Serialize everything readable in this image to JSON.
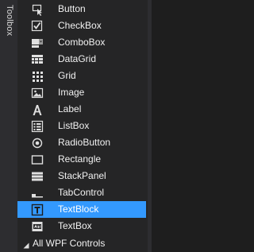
{
  "toolbox_tab": {
    "label": "Toolbox"
  },
  "items": [
    {
      "label": "Button",
      "icon": "button-pointer-icon"
    },
    {
      "label": "CheckBox",
      "icon": "checkbox-icon"
    },
    {
      "label": "ComboBox",
      "icon": "combobox-icon"
    },
    {
      "label": "DataGrid",
      "icon": "datagrid-icon"
    },
    {
      "label": "Grid",
      "icon": "grid-icon"
    },
    {
      "label": "Image",
      "icon": "image-icon"
    },
    {
      "label": "Label",
      "icon": "label-a-icon"
    },
    {
      "label": "ListBox",
      "icon": "listbox-icon"
    },
    {
      "label": "RadioButton",
      "icon": "radio-button-icon"
    },
    {
      "label": "Rectangle",
      "icon": "rectangle-icon"
    },
    {
      "label": "StackPanel",
      "icon": "stackpanel-icon"
    },
    {
      "label": "TabControl",
      "icon": "tabcontrol-icon"
    },
    {
      "label": "TextBlock",
      "icon": "textblock-icon",
      "selected": true
    },
    {
      "label": "TextBox",
      "icon": "textbox-icon"
    }
  ],
  "group": {
    "label": "All WPF Controls",
    "icon": "chevron-collapse-icon"
  },
  "colors": {
    "selection": "#3399ff",
    "panel_bg": "#252526",
    "editor_bg": "#1e1e1e",
    "text": "#f1f1f1"
  }
}
